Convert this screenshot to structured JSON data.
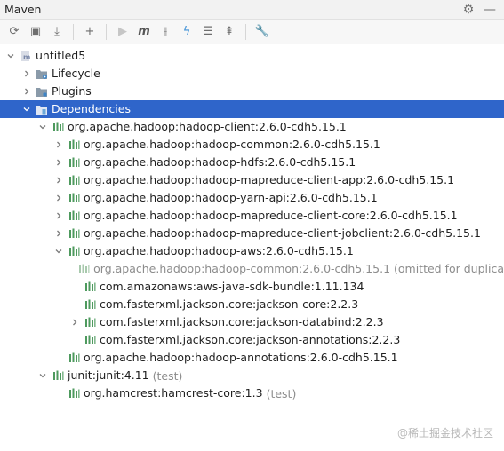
{
  "window": {
    "title": "Maven",
    "actions": [
      {
        "name": "settings-gear-icon",
        "glyph": "⚙"
      },
      {
        "name": "minimize-icon",
        "glyph": "—"
      }
    ]
  },
  "toolbar": [
    {
      "name": "reload-button",
      "glyph": "⟳",
      "enabled": true
    },
    {
      "name": "generate-sources-button",
      "glyph": "▣",
      "enabled": true
    },
    {
      "name": "download-button",
      "glyph": "⤓",
      "enabled": true
    },
    {
      "sep": true
    },
    {
      "name": "add-button",
      "glyph": "+",
      "enabled": true
    },
    {
      "sep": true
    },
    {
      "name": "run-button",
      "glyph": "▶",
      "enabled": false
    },
    {
      "name": "execute-goal-button",
      "glyph": "m",
      "enabled": true
    },
    {
      "name": "toggle-offline-button",
      "glyph": "⫲",
      "enabled": true
    },
    {
      "name": "skip-tests-button",
      "glyph": "ϟ",
      "enabled": true
    },
    {
      "name": "show-dependencies-button",
      "glyph": "☰",
      "enabled": true
    },
    {
      "name": "collapse-all-button",
      "glyph": "⇞",
      "enabled": true
    },
    {
      "sep": true
    },
    {
      "name": "settings-wrench-button",
      "glyph": "🔧",
      "enabled": true
    }
  ],
  "tree": [
    {
      "depth": 0,
      "arrow": "down",
      "icon": "maven-project-icon",
      "text": "untitled5"
    },
    {
      "depth": 1,
      "arrow": "right",
      "icon": "lifecycle-folder-icon",
      "text": "Lifecycle"
    },
    {
      "depth": 1,
      "arrow": "right",
      "icon": "plugins-folder-icon",
      "text": "Plugins"
    },
    {
      "depth": 1,
      "arrow": "down",
      "icon": "dependencies-folder-icon",
      "text": "Dependencies",
      "selected": true
    },
    {
      "depth": 2,
      "arrow": "down",
      "icon": "library-icon",
      "text": "org.apache.hadoop:hadoop-client:2.6.0-cdh5.15.1"
    },
    {
      "depth": 3,
      "arrow": "right",
      "icon": "library-icon",
      "text": "org.apache.hadoop:hadoop-common:2.6.0-cdh5.15.1"
    },
    {
      "depth": 3,
      "arrow": "right",
      "icon": "library-icon",
      "text": "org.apache.hadoop:hadoop-hdfs:2.6.0-cdh5.15.1"
    },
    {
      "depth": 3,
      "arrow": "right",
      "icon": "library-icon",
      "text": "org.apache.hadoop:hadoop-mapreduce-client-app:2.6.0-cdh5.15.1"
    },
    {
      "depth": 3,
      "arrow": "right",
      "icon": "library-icon",
      "text": "org.apache.hadoop:hadoop-yarn-api:2.6.0-cdh5.15.1"
    },
    {
      "depth": 3,
      "arrow": "right",
      "icon": "library-icon",
      "text": "org.apache.hadoop:hadoop-mapreduce-client-core:2.6.0-cdh5.15.1"
    },
    {
      "depth": 3,
      "arrow": "right",
      "icon": "library-icon",
      "text": "org.apache.hadoop:hadoop-mapreduce-client-jobclient:2.6.0-cdh5.15.1"
    },
    {
      "depth": 3,
      "arrow": "down",
      "icon": "library-icon",
      "text": "org.apache.hadoop:hadoop-aws:2.6.0-cdh5.15.1"
    },
    {
      "depth": 4,
      "arrow": "none",
      "icon": "library-icon",
      "text": "org.apache.hadoop:hadoop-common:2.6.0-cdh5.15.1 (omitted for duplica",
      "muted": true
    },
    {
      "depth": 4,
      "arrow": "none",
      "icon": "library-icon",
      "text": "com.amazonaws:aws-java-sdk-bundle:1.11.134"
    },
    {
      "depth": 4,
      "arrow": "none",
      "icon": "library-icon",
      "text": "com.fasterxml.jackson.core:jackson-core:2.2.3"
    },
    {
      "depth": 4,
      "arrow": "right",
      "icon": "library-icon",
      "text": "com.fasterxml.jackson.core:jackson-databind:2.2.3"
    },
    {
      "depth": 4,
      "arrow": "none",
      "icon": "library-icon",
      "text": "com.fasterxml.jackson.core:jackson-annotations:2.2.3"
    },
    {
      "depth": 3,
      "arrow": "none",
      "icon": "library-icon",
      "text": "org.apache.hadoop:hadoop-annotations:2.6.0-cdh5.15.1"
    },
    {
      "depth": 2,
      "arrow": "down",
      "icon": "library-icon",
      "text": "junit:junit:4.11",
      "suffix": "(test)"
    },
    {
      "depth": 3,
      "arrow": "none",
      "icon": "library-icon",
      "text": "org.hamcrest:hamcrest-core:1.3",
      "suffix": "(test)"
    }
  ],
  "watermark": "@稀土掘金技术社区",
  "colors": {
    "selection": "#2f65ca",
    "library_icon": "#4e9a5e",
    "folder_icon": "#8a9aa9",
    "maven_icon": "#7a88a8"
  }
}
